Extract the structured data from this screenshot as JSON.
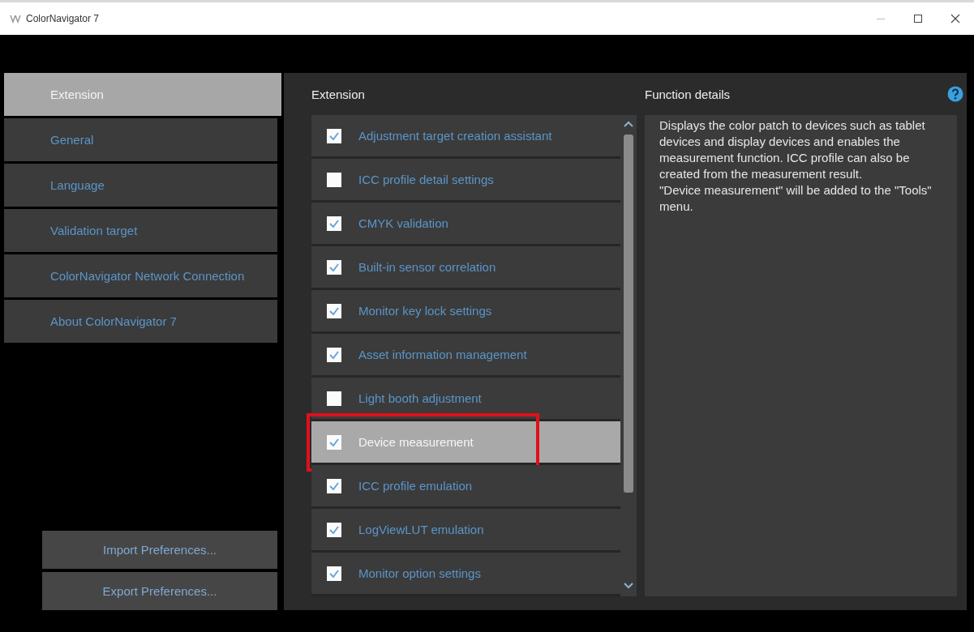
{
  "window": {
    "title": "ColorNavigator 7"
  },
  "sidebar": {
    "items": [
      {
        "label": "Extension",
        "selected": true
      },
      {
        "label": "General",
        "selected": false
      },
      {
        "label": "Language",
        "selected": false
      },
      {
        "label": "Validation target",
        "selected": false
      },
      {
        "label": "ColorNavigator Network Connection",
        "selected": false
      },
      {
        "label": "About ColorNavigator 7",
        "selected": false
      }
    ],
    "buttons": [
      "Import Preferences...",
      "Export Preferences..."
    ]
  },
  "extension": {
    "heading": "Extension",
    "items": [
      {
        "label": "Adjustment target creation assistant",
        "checked": true,
        "selected": false,
        "highlighted": false
      },
      {
        "label": "ICC profile detail settings",
        "checked": false,
        "selected": false,
        "highlighted": false
      },
      {
        "label": "CMYK validation",
        "checked": true,
        "selected": false,
        "highlighted": false
      },
      {
        "label": "Built-in sensor correlation",
        "checked": true,
        "selected": false,
        "highlighted": false
      },
      {
        "label": "Monitor key lock settings",
        "checked": true,
        "selected": false,
        "highlighted": false
      },
      {
        "label": "Asset information management",
        "checked": true,
        "selected": false,
        "highlighted": false
      },
      {
        "label": "Light booth adjustment",
        "checked": false,
        "selected": false,
        "highlighted": false
      },
      {
        "label": "Device measurement",
        "checked": true,
        "selected": true,
        "highlighted": true
      },
      {
        "label": "ICC profile emulation",
        "checked": true,
        "selected": false,
        "highlighted": false
      },
      {
        "label": "LogViewLUT emulation",
        "checked": true,
        "selected": false,
        "highlighted": false
      },
      {
        "label": "Monitor option settings",
        "checked": true,
        "selected": false,
        "highlighted": false
      }
    ]
  },
  "function_details": {
    "heading": "Function details",
    "paragraphs": [
      "Displays the color patch to devices such as tablet devices and display devices and enables the measurement function. ICC profile can also be created from the measurement result.",
      "\"Device measurement\" will be added to the \"Tools\" menu."
    ]
  }
}
